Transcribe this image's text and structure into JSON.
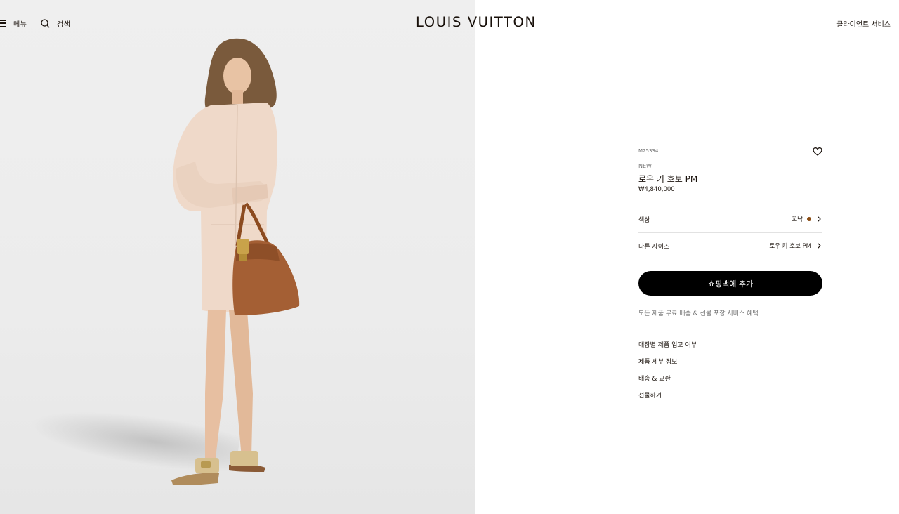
{
  "header": {
    "menu_label": "메뉴",
    "search_label": "검색",
    "logo": "LOUIS VUITTON",
    "client_service": "클라이언트 서비스"
  },
  "hero": {
    "icon": "model-photo"
  },
  "product": {
    "sku": "M25334",
    "badge": "NEW",
    "name": "로우 키 호보 PM",
    "price": "₩4,840,000",
    "wishlist_icon": "heart-icon"
  },
  "options": {
    "color": {
      "label": "색상",
      "value": "꼬냑",
      "swatch": "#8a4b12"
    },
    "size": {
      "label": "다른 사이즈",
      "value": "로우 키 호보 PM"
    }
  },
  "cta": {
    "label": "쇼핑백에 추가"
  },
  "benefit": "모든 제품 무료 배송 & 선물 포장 서비스 혜택",
  "links": [
    {
      "label": "매장별 제품 입고 여부"
    },
    {
      "label": "제품 세부 정보"
    },
    {
      "label": "배송 & 교환"
    },
    {
      "label": "선물하기"
    }
  ],
  "colors": {
    "text": "#19110b",
    "button": "#000000",
    "hero_bg": "#efefef"
  }
}
